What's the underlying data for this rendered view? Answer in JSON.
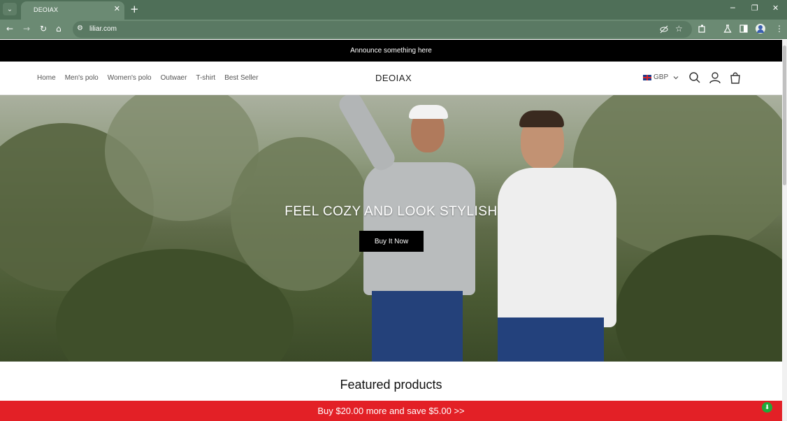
{
  "browser": {
    "tab_title": "DEOIAX",
    "url": "liliar.com",
    "tab_close": "✕",
    "new_tab": "+",
    "dropdown": "⌄",
    "window_controls": [
      "─",
      "❐",
      "✕"
    ]
  },
  "announcement": "Announce something here",
  "header": {
    "brand": "DEOIAX",
    "nav": [
      "Home",
      "Men's polo",
      "Women's polo",
      "Outwaer",
      "T-shirt",
      "Best Seller"
    ],
    "currency": "GBP"
  },
  "hero": {
    "headline": "FEEL COZY AND LOOK STYLISH",
    "button_label": "Buy It Now"
  },
  "featured_title": "Featured products",
  "promo_bar": "Buy $20.00 more and save $5.00  >>",
  "colors": {
    "browser_chrome": "#4f6f58",
    "toolbar": "#6b8a73",
    "announce_bg": "#000000",
    "promo_bg": "#e32026",
    "button_bg": "#000000"
  }
}
